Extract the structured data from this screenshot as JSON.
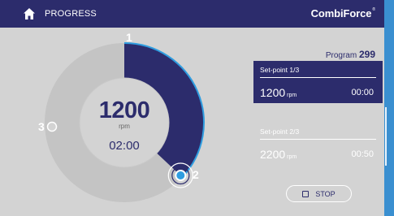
{
  "header": {
    "title": "PROGRESS",
    "brand": "CombiForce",
    "brand_mark": "®",
    "home_icon": "home-icon"
  },
  "dial": {
    "markers": {
      "one": "1",
      "two": "2",
      "three": "3"
    },
    "speed": "1200",
    "unit": "rpm",
    "time": "02:00",
    "progress_fraction": 0.37
  },
  "program": {
    "label": "Program",
    "number": "299"
  },
  "setpoints": [
    {
      "label": "Set-point 1/3",
      "speed": "1200",
      "unit": "rpm",
      "time": "00:00"
    },
    {
      "label": "Set-point 2/3",
      "speed": "2200",
      "unit": "rpm",
      "time": "00:50"
    }
  ],
  "stop": {
    "label": "STOP"
  },
  "colors": {
    "navy": "#2c2c6c",
    "accent": "#2f9de0",
    "panel": "#d3d3d3",
    "frame": "#3a8fd0"
  }
}
